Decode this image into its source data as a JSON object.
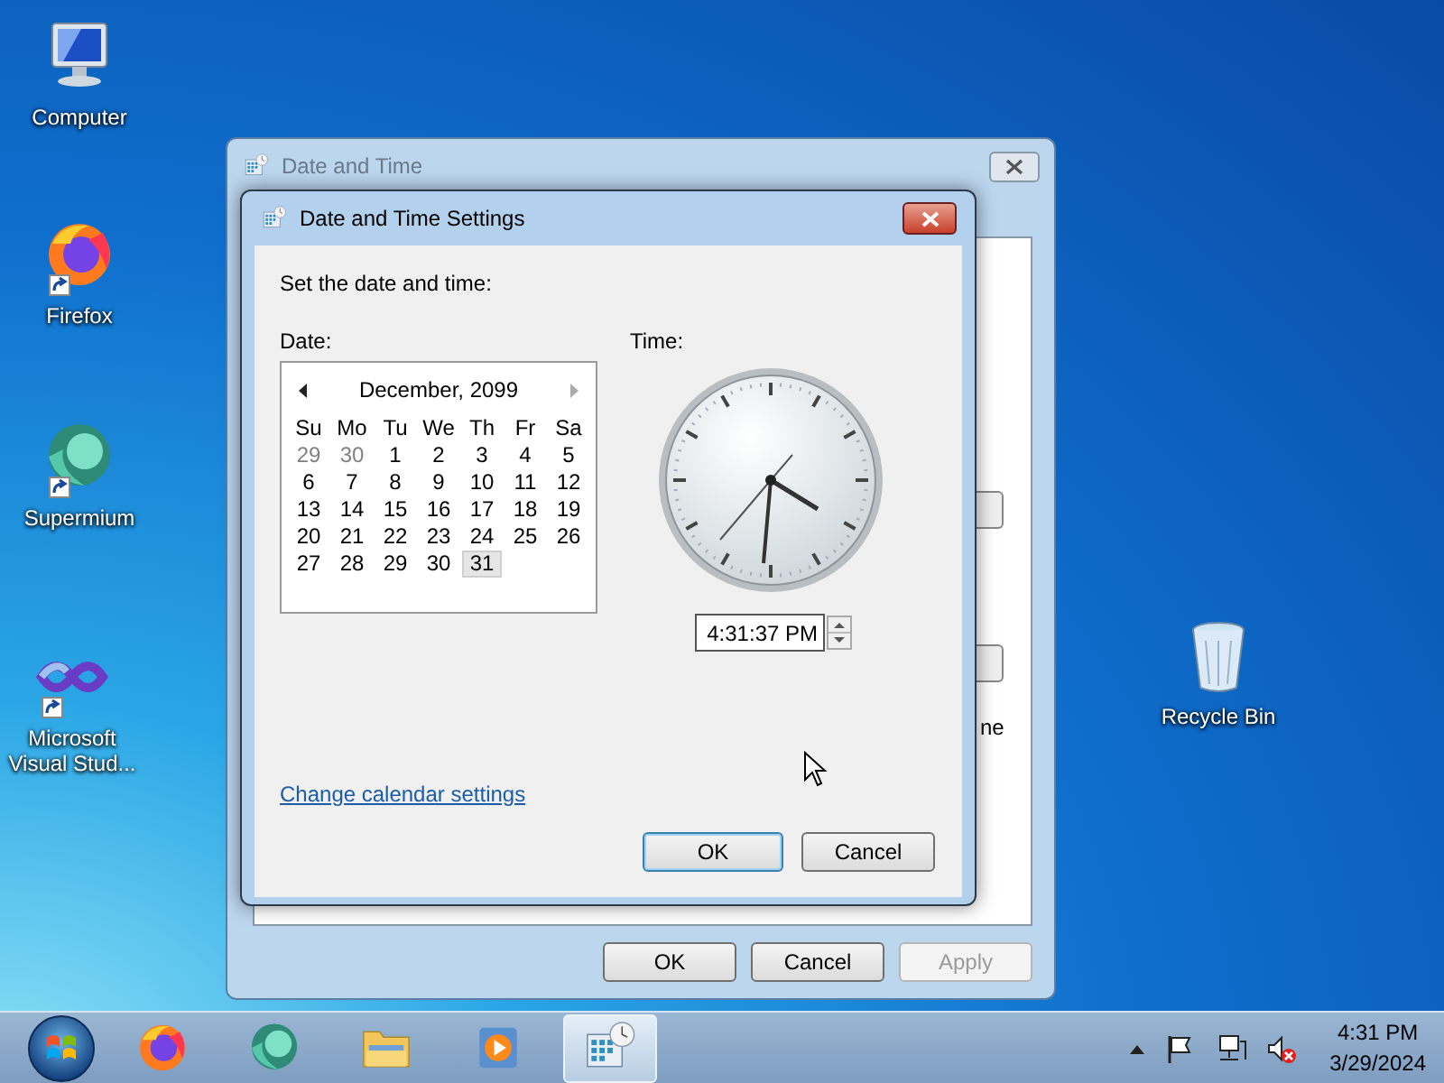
{
  "desktop_icons": [
    {
      "kind": "computer",
      "label": "Computer",
      "shortcut": false
    },
    {
      "kind": "firefox",
      "label": "Firefox",
      "shortcut": true
    },
    {
      "kind": "supermium",
      "label": "Supermium",
      "shortcut": true
    },
    {
      "kind": "visualstudio",
      "label": "Microsoft Visual Stud...",
      "shortcut": true
    },
    {
      "kind": "recyclebin",
      "label": "Recycle Bin",
      "shortcut": false
    }
  ],
  "back_window": {
    "title": "Date and Time",
    "partial_text": "ne",
    "buttons": [
      {
        "label": "OK",
        "disabled": false
      },
      {
        "label": "Cancel",
        "disabled": false
      },
      {
        "label": "Apply",
        "disabled": true
      }
    ]
  },
  "dialog": {
    "title": "Date and Time Settings",
    "prompt": "Set the date and time:",
    "date_label": "Date:",
    "time_label": "Time:",
    "calendar": {
      "month": "December, 2099",
      "weekdays": [
        "Su",
        "Mo",
        "Tu",
        "We",
        "Th",
        "Fr",
        "Sa"
      ],
      "days": [
        {
          "label": "29",
          "other_month": true,
          "selected": false
        },
        {
          "label": "30",
          "other_month": true,
          "selected": false
        },
        {
          "label": "1",
          "other_month": false,
          "selected": false
        },
        {
          "label": "2",
          "other_month": false,
          "selected": false
        },
        {
          "label": "3",
          "other_month": false,
          "selected": false
        },
        {
          "label": "4",
          "other_month": false,
          "selected": false
        },
        {
          "label": "5",
          "other_month": false,
          "selected": false
        },
        {
          "label": "6",
          "other_month": false,
          "selected": false
        },
        {
          "label": "7",
          "other_month": false,
          "selected": false
        },
        {
          "label": "8",
          "other_month": false,
          "selected": false
        },
        {
          "label": "9",
          "other_month": false,
          "selected": false
        },
        {
          "label": "10",
          "other_month": false,
          "selected": false
        },
        {
          "label": "11",
          "other_month": false,
          "selected": false
        },
        {
          "label": "12",
          "other_month": false,
          "selected": false
        },
        {
          "label": "13",
          "other_month": false,
          "selected": false
        },
        {
          "label": "14",
          "other_month": false,
          "selected": false
        },
        {
          "label": "15",
          "other_month": false,
          "selected": false
        },
        {
          "label": "16",
          "other_month": false,
          "selected": false
        },
        {
          "label": "17",
          "other_month": false,
          "selected": false
        },
        {
          "label": "18",
          "other_month": false,
          "selected": false
        },
        {
          "label": "19",
          "other_month": false,
          "selected": false
        },
        {
          "label": "20",
          "other_month": false,
          "selected": false
        },
        {
          "label": "21",
          "other_month": false,
          "selected": false
        },
        {
          "label": "22",
          "other_month": false,
          "selected": false
        },
        {
          "label": "23",
          "other_month": false,
          "selected": false
        },
        {
          "label": "24",
          "other_month": false,
          "selected": false
        },
        {
          "label": "25",
          "other_month": false,
          "selected": false
        },
        {
          "label": "26",
          "other_month": false,
          "selected": false
        },
        {
          "label": "27",
          "other_month": false,
          "selected": false
        },
        {
          "label": "28",
          "other_month": false,
          "selected": false
        },
        {
          "label": "29",
          "other_month": false,
          "selected": false
        },
        {
          "label": "30",
          "other_month": false,
          "selected": false
        },
        {
          "label": "31",
          "other_month": false,
          "selected": true
        }
      ]
    },
    "time_value": "4:31:37 PM",
    "link": "Change calendar settings",
    "buttons": [
      {
        "label": "OK",
        "default": true
      },
      {
        "label": "Cancel",
        "default": false
      }
    ]
  },
  "taskbar": {
    "items": [
      {
        "kind": "firefox",
        "active": false
      },
      {
        "kind": "supermium",
        "active": false
      },
      {
        "kind": "explorer",
        "active": false
      },
      {
        "kind": "mediaplayer",
        "active": false
      },
      {
        "kind": "datetime",
        "active": true
      }
    ],
    "tray_time": "4:31 PM",
    "tray_date": "3/29/2024"
  }
}
